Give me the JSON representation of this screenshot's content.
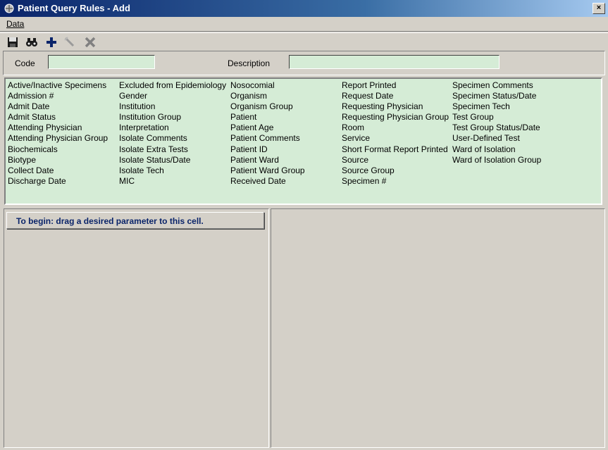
{
  "window": {
    "title": "Patient Query Rules - Add",
    "close_label": "×"
  },
  "menu": {
    "data_label": "Data"
  },
  "toolbar": {
    "icons": [
      "save-icon",
      "find-binoculars-icon",
      "add-plus-icon",
      "edit-wand-icon",
      "delete-x-icon"
    ]
  },
  "form": {
    "code_label": "Code",
    "code_value": "",
    "description_label": "Description",
    "description_value": ""
  },
  "parameters": {
    "columns": [
      [
        "Active/Inactive Specimens",
        "Admission #",
        "Admit Date",
        "Admit Status",
        "Attending Physician",
        "Attending Physician Group",
        "Biochemicals",
        "Biotype",
        "Collect Date",
        "Discharge Date"
      ],
      [
        "Excluded from Epidemiology",
        "Gender",
        "Institution",
        "Institution Group",
        "Interpretation",
        "Isolate Comments",
        "Isolate Extra Tests",
        "Isolate Status/Date",
        "Isolate Tech",
        "MIC"
      ],
      [
        "Nosocomial",
        "Organism",
        "Organism Group",
        "Patient",
        "Patient Age",
        "Patient Comments",
        "Patient ID",
        "Patient Ward",
        "Patient Ward Group",
        "Received Date"
      ],
      [
        "Report Printed",
        "Request Date",
        "Requesting Physician",
        "Requesting Physician Group",
        "Room",
        "Service",
        "Short Format Report Printed",
        "Source",
        "Source Group",
        "Specimen #"
      ],
      [
        "Specimen Comments",
        "Specimen Status/Date",
        "Specimen Tech",
        "Test Group",
        "Test Group Status/Date",
        "User-Defined Test",
        "Ward of Isolation",
        "Ward of Isolation Group"
      ]
    ]
  },
  "builder": {
    "drop_hint": "To begin: drag a desired parameter to this cell."
  },
  "colors": {
    "field_bg": "#d5ecd6",
    "title_start": "#0a246a",
    "hint_text": "#0a246a"
  }
}
